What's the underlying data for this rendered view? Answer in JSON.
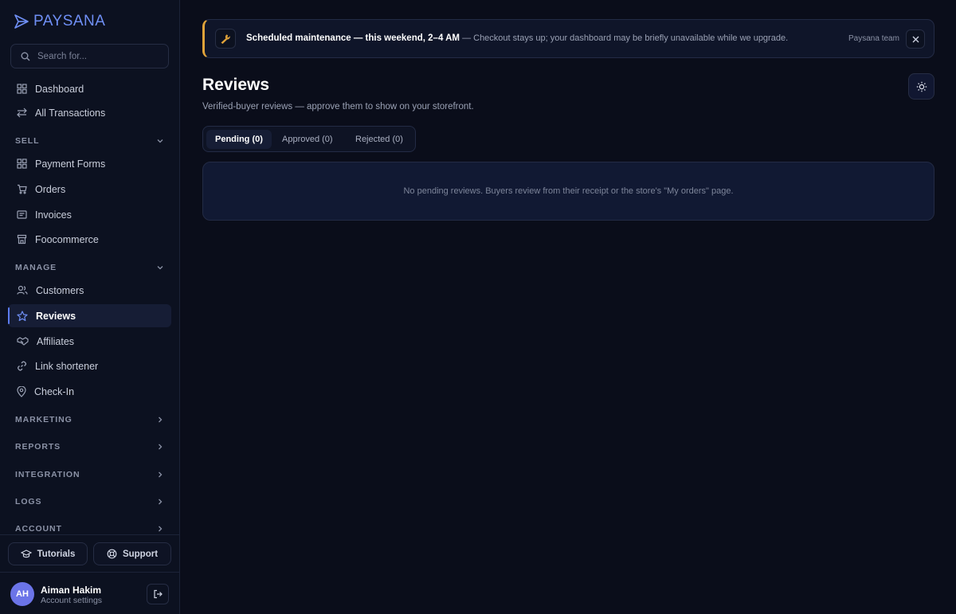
{
  "app": {
    "brand": "PAYSANA"
  },
  "search": {
    "placeholder": "Search for..."
  },
  "nav": {
    "dashboard": "Dashboard",
    "all_transactions": "All Transactions",
    "sell_section": "SELL",
    "payment_forms": "Payment Forms",
    "orders": "Orders",
    "invoices": "Invoices",
    "foocommerce": "Foocommerce",
    "manage_section": "MANAGE",
    "customers": "Customers",
    "reviews": "Reviews",
    "affiliates": "Affiliates",
    "link_shortener": "Link shortener",
    "check_in": "Check-In",
    "marketing_section": "MARKETING",
    "reports_section": "REPORTS",
    "integration_section": "INTEGRATION",
    "logs_section": "LOGS",
    "account_section": "ACCOUNT"
  },
  "footer": {
    "tutorials": "Tutorials",
    "support": "Support",
    "user_initials": "AH",
    "user_name": "Aiman Hakim",
    "user_sub": "Account settings"
  },
  "banner": {
    "title": "Scheduled maintenance — this weekend, 2–4 AM",
    "message": "— Checkout stays up; your dashboard may be briefly unavailable while we upgrade.",
    "author": "Paysana team"
  },
  "page": {
    "title": "Reviews",
    "subtitle": "Verified-buyer reviews — approve them to show on your storefront.",
    "tabs": [
      "Pending (0)",
      "Approved (0)",
      "Rejected (0)"
    ],
    "empty_message": "No pending reviews. Buyers review from their receipt or the store's \"My orders\" page."
  },
  "colors": {
    "accent": "#5b7cf0",
    "warning": "#e0a33a",
    "background": "#0a0d1a"
  }
}
